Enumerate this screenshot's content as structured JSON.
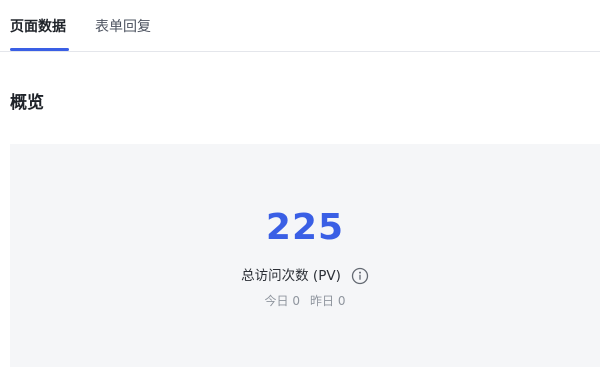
{
  "tabs": [
    {
      "label": "页面数据",
      "active": true
    },
    {
      "label": "表单回复",
      "active": false
    }
  ],
  "overview": {
    "title": "概览"
  },
  "stats": {
    "total_value": "225",
    "total_label": "总访问次数 (PV)",
    "today": "今日 0",
    "yesterday": "昨日 0"
  },
  "colors": {
    "accent": "#3a5fe5",
    "card_bg": "#f5f6f8"
  },
  "icons": {
    "info": "info-circle-icon"
  }
}
